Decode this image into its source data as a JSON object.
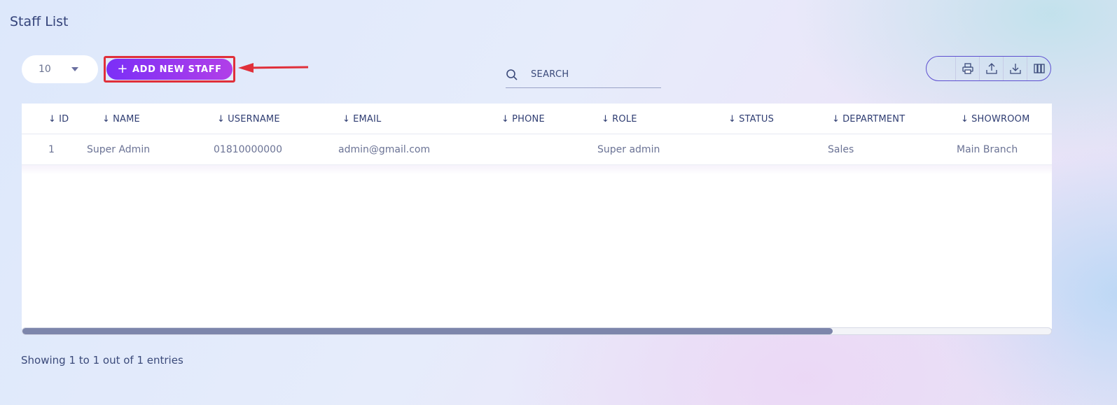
{
  "page": {
    "title": "Staff List"
  },
  "controls": {
    "page_size": "10",
    "add_button_label": "ADD NEW STAFF",
    "search_label": "SEARCH"
  },
  "toolbar": {
    "icons": [
      "print-icon",
      "export-icon",
      "download-icon",
      "columns-icon"
    ]
  },
  "table": {
    "headers": [
      "ID",
      "NAME",
      "USERNAME",
      "EMAIL",
      "PHONE",
      "ROLE",
      "STATUS",
      "DEPARTMENT",
      "SHOWROOM"
    ],
    "rows": [
      {
        "id": "1",
        "name": "Super Admin",
        "username": "01810000000",
        "email": "admin@gmail.com",
        "phone": "",
        "role": "Super admin",
        "status": "",
        "department": "Sales",
        "showroom": "Main Branch"
      }
    ]
  },
  "footer": {
    "summary": "Showing 1 to 1 out of 1 entries"
  },
  "colors": {
    "accent_start": "#7b2ff7",
    "accent_end": "#b13fe8",
    "highlight": "#e0303a"
  }
}
